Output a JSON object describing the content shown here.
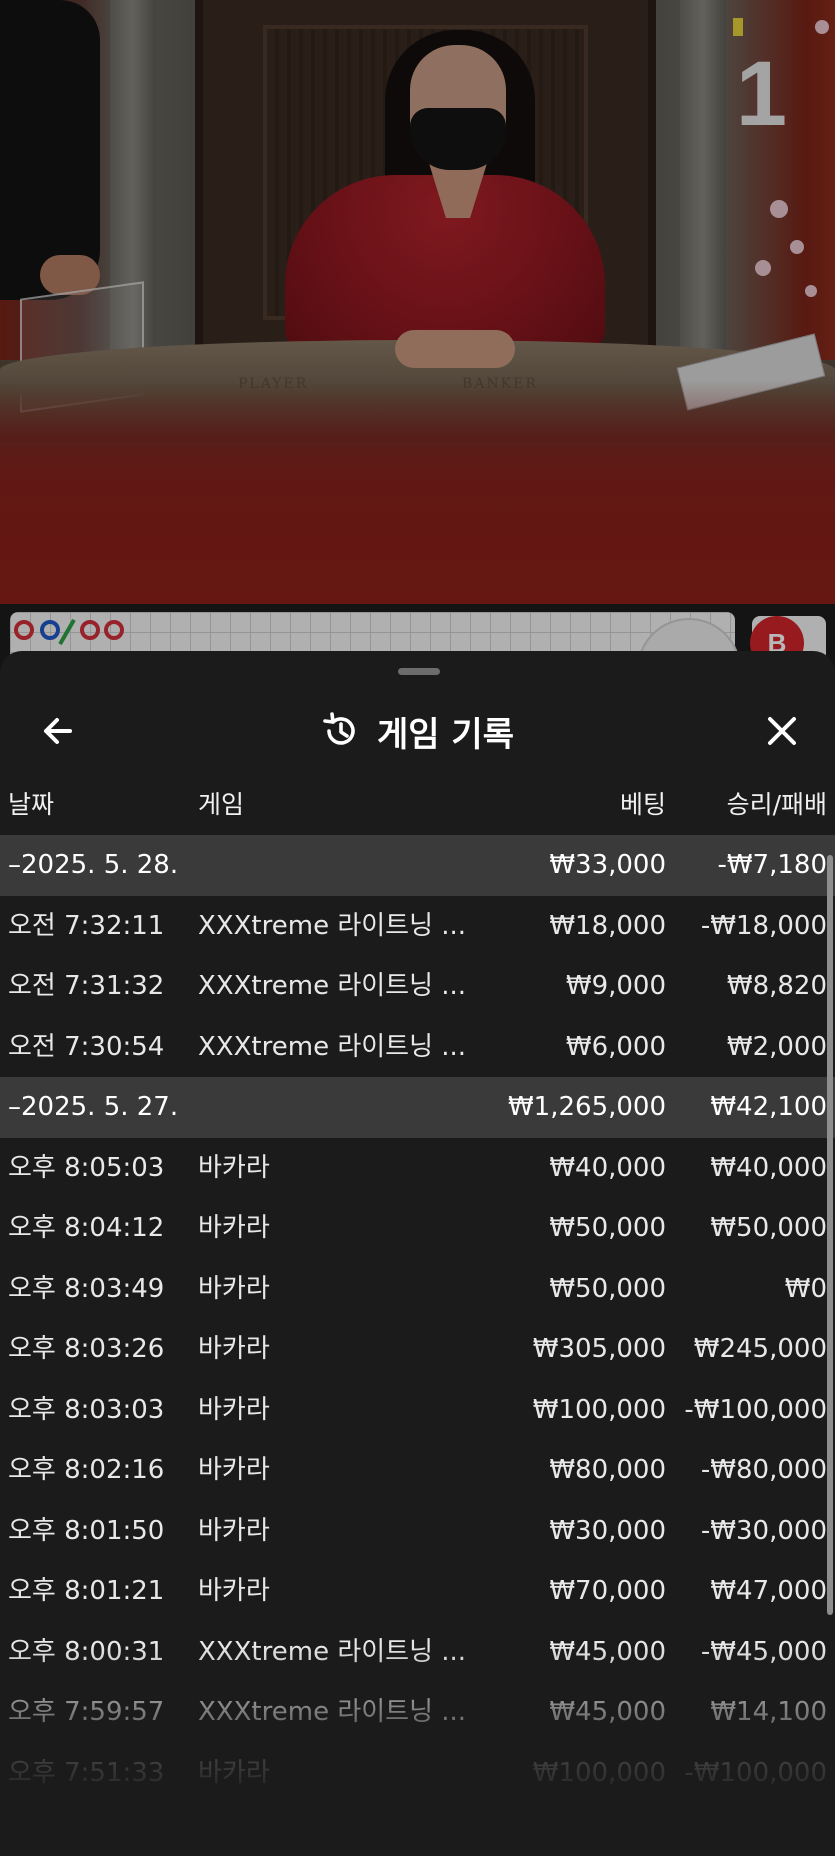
{
  "video": {
    "round_number": "1",
    "table_labels": {
      "player": "PLAYER",
      "banker": "BANKER"
    }
  },
  "roadmap": {
    "banker_badge": "B"
  },
  "history": {
    "title": "게임 기록",
    "icons": {
      "back": "arrow-left-icon",
      "title": "history-icon",
      "close": "close-icon"
    },
    "columns": {
      "date": "날짜",
      "game": "게임",
      "bet": "베팅",
      "win_loss": "승리/패배"
    },
    "rows": [
      {
        "type": "group",
        "date": "–2025. 5. 28.",
        "game": "",
        "bet": "₩33,000",
        "win_loss": "-₩7,180"
      },
      {
        "type": "item",
        "date": "오전 7:32:11",
        "game": "XXXtreme 라이트닝 ...",
        "bet": "₩18,000",
        "win_loss": "-₩18,000"
      },
      {
        "type": "item",
        "date": "오전 7:31:32",
        "game": "XXXtreme 라이트닝 ...",
        "bet": "₩9,000",
        "win_loss": "₩8,820"
      },
      {
        "type": "item",
        "date": "오전 7:30:54",
        "game": "XXXtreme 라이트닝 ...",
        "bet": "₩6,000",
        "win_loss": "₩2,000"
      },
      {
        "type": "group",
        "date": "–2025. 5. 27.",
        "game": "",
        "bet": "₩1,265,000",
        "win_loss": "₩42,100"
      },
      {
        "type": "item",
        "date": "오후 8:05:03",
        "game": "바카라",
        "bet": "₩40,000",
        "win_loss": "₩40,000"
      },
      {
        "type": "item",
        "date": "오후 8:04:12",
        "game": "바카라",
        "bet": "₩50,000",
        "win_loss": "₩50,000"
      },
      {
        "type": "item",
        "date": "오후 8:03:49",
        "game": "바카라",
        "bet": "₩50,000",
        "win_loss": "₩0"
      },
      {
        "type": "item",
        "date": "오후 8:03:26",
        "game": "바카라",
        "bet": "₩305,000",
        "win_loss": "₩245,000"
      },
      {
        "type": "item",
        "date": "오후 8:03:03",
        "game": "바카라",
        "bet": "₩100,000",
        "win_loss": "-₩100,000"
      },
      {
        "type": "item",
        "date": "오후 8:02:16",
        "game": "바카라",
        "bet": "₩80,000",
        "win_loss": "-₩80,000"
      },
      {
        "type": "item",
        "date": "오후 8:01:50",
        "game": "바카라",
        "bet": "₩30,000",
        "win_loss": "-₩30,000"
      },
      {
        "type": "item",
        "date": "오후 8:01:21",
        "game": "바카라",
        "bet": "₩70,000",
        "win_loss": "₩47,000"
      },
      {
        "type": "item",
        "date": "오후 8:00:31",
        "game": "XXXtreme 라이트닝 ...",
        "bet": "₩45,000",
        "win_loss": "-₩45,000"
      },
      {
        "type": "item",
        "date": "오후 7:59:57",
        "game": "XXXtreme 라이트닝 ...",
        "bet": "₩45,000",
        "win_loss": "₩14,100"
      },
      {
        "type": "item",
        "date": "오후 7:51:33",
        "game": "바카라",
        "bet": "₩100,000",
        "win_loss": "-₩100,000"
      }
    ]
  }
}
